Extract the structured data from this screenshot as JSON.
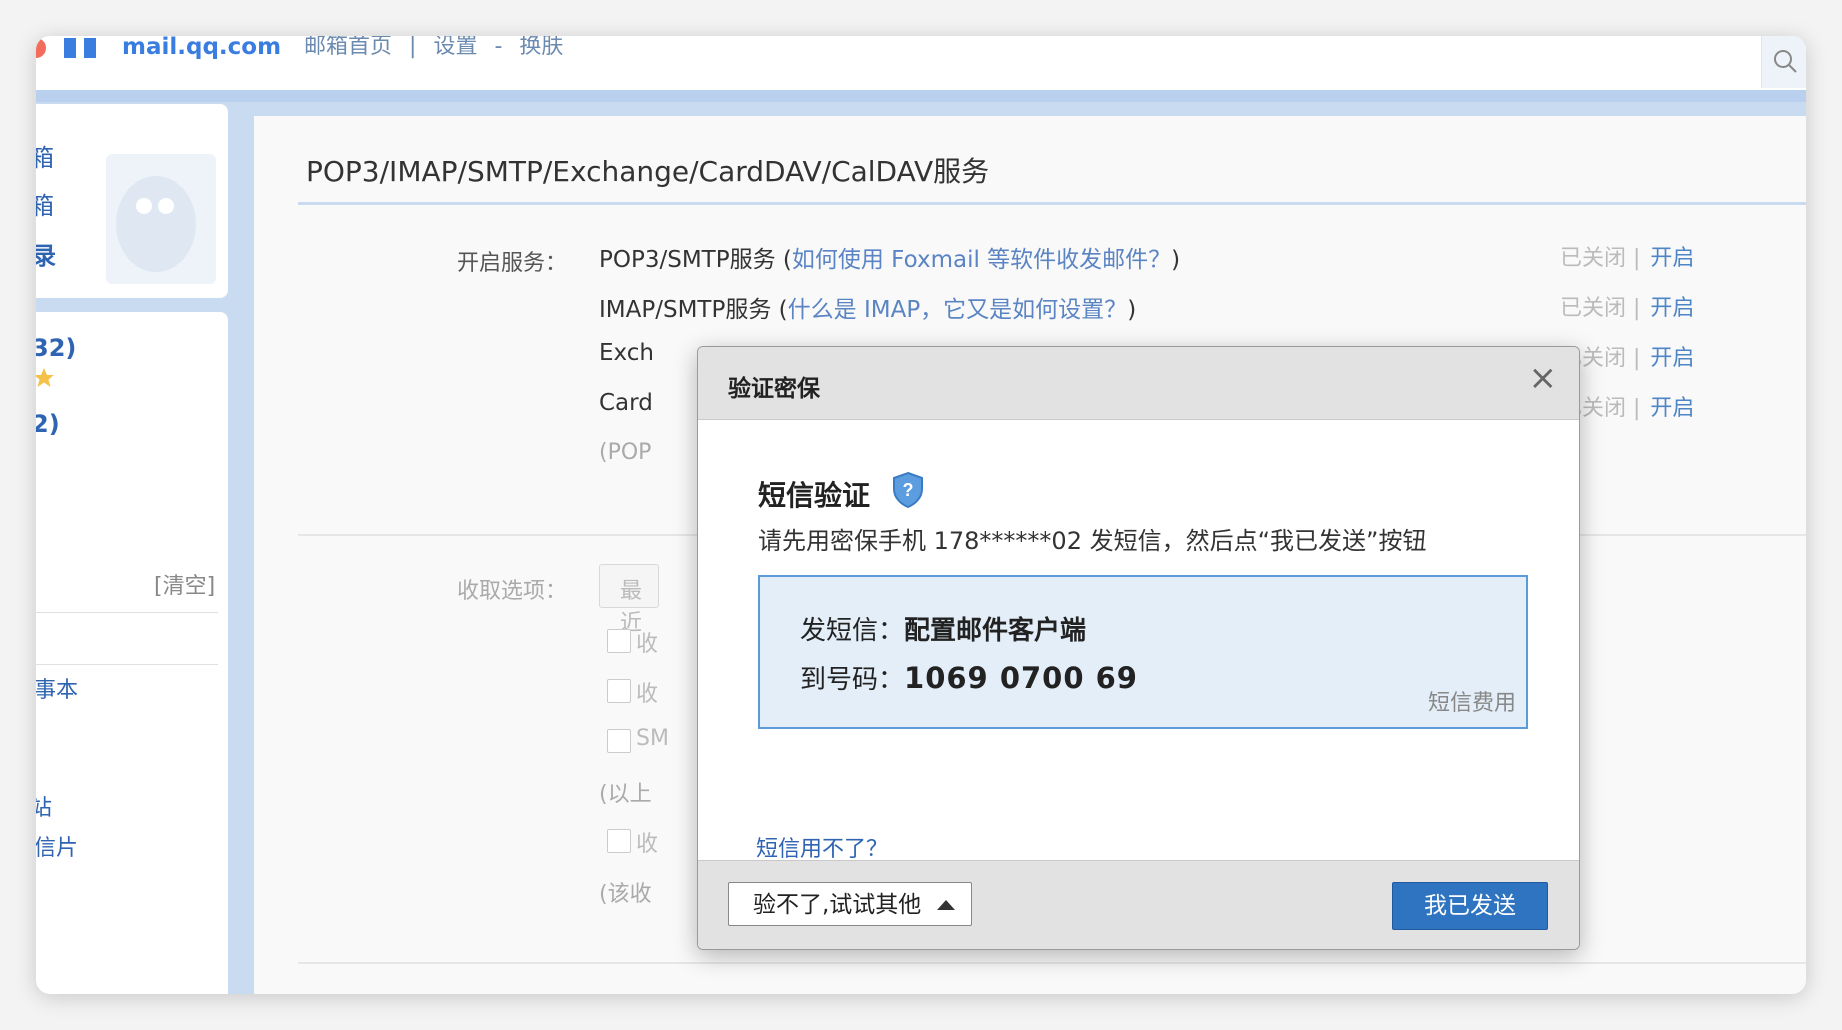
{
  "header": {
    "domain": "mail.qq.com",
    "links": [
      "邮箱首页",
      "|",
      "设置",
      "-",
      "换肤"
    ]
  },
  "sidebar": {
    "item_partial_1": "箱",
    "item_partial_2": "箱",
    "item_partial_3": "录",
    "count_1": "32)",
    "count_2": "2)",
    "clear": "[清空]",
    "item_notebook": "事本",
    "item_station": "站",
    "item_postcard": "信片"
  },
  "main": {
    "title": "POP3/IMAP/SMTP/Exchange/CardDAV/CalDAV服务",
    "service_label": "开启服务：",
    "services": [
      {
        "name": "POP3/SMTP服务 (",
        "link": "如何使用 Foxmail 等软件收发邮件？",
        "tail": ")",
        "status": "已关闭 |",
        "action": "开启"
      },
      {
        "name": "IMAP/SMTP服务 (",
        "link": "什么是 IMAP，它又是如何设置？",
        "tail": ")",
        "status": "已关闭 |",
        "action": "开启"
      },
      {
        "name": "Exch",
        "link": "",
        "tail": "",
        "status": "已关闭 |",
        "action": "开启"
      },
      {
        "name": "Card",
        "link": "",
        "tail": "",
        "status": "已关闭 |",
        "action": "开启"
      }
    ],
    "pop_note": "(POP",
    "receive_label": "收取选项：",
    "select_stub": "最近",
    "options": [
      "收",
      "收",
      "SM",
      "收"
    ],
    "note_above": "(以上",
    "note_bottom": "(该收"
  },
  "dialog": {
    "title": "验证密保",
    "close": "×",
    "sms_title": "短信验证",
    "desc": "请先用密保手机 178******02 发短信，然后点“我已发送”按钮",
    "send_label": "发短信：",
    "send_content": "配置邮件客户端",
    "to_label": "到号码：",
    "to_number": "1069 0700 69",
    "fee": "短信费用",
    "help": "短信用不了？",
    "btn_other": "验不了,试试其他",
    "btn_sent": "我已发送"
  },
  "colors": {
    "accent": "#2f74c0",
    "link": "#5a84c3",
    "sidebar_bg": "#c9dbf1",
    "sms_box_bg": "#e3eef8"
  }
}
